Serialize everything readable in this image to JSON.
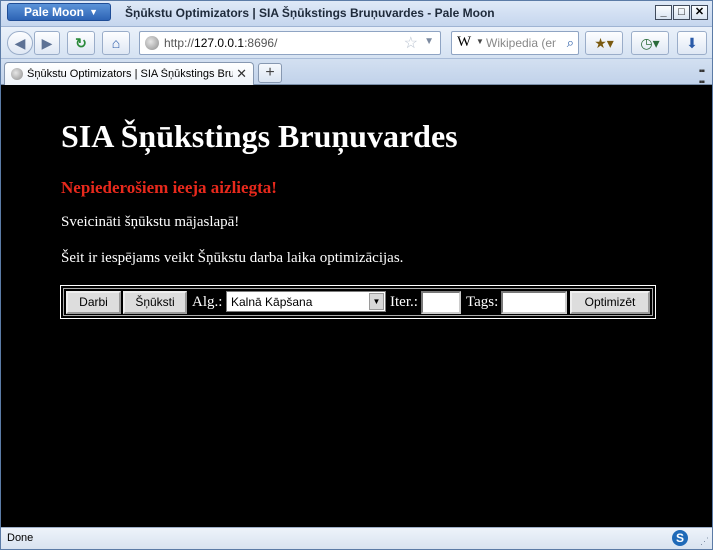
{
  "window": {
    "app_button": "Pale Moon",
    "title": "Šņūkstu Optimizators | SIA Šņūkstings Bruņuvardes - Pale Moon",
    "controls": [
      "_",
      "□",
      "✕"
    ]
  },
  "navbar": {
    "url_prefix": "http://",
    "url_host": "127.0.0.1",
    "url_rest": ":8696/",
    "search_placeholder": "Wikipedia (en)",
    "search_engine_letter": "W"
  },
  "tab": {
    "label": "Šņūkstu Optimizators | SIA Šņūkstings Bruņuvardes",
    "close": "✕",
    "new_tab": "+"
  },
  "page": {
    "heading": "SIA Šņūkstings Bruņuvardes",
    "warning": "Nepiederošiem ieeja aizliegta!",
    "greeting": "Sveicināti šņūkstu mājaslapā!",
    "description": "Šeit ir iespējams veikt Šņūkstu darba laika optimizācijas.",
    "form": {
      "darbi_label": "Darbi",
      "snuksti_label": "Šņūksti",
      "alg_label": "Alg.:",
      "alg_value": "Kalnā Kāpšana",
      "iter_label": "Iter.:",
      "iter_value": "",
      "tags_label": "Tags:",
      "tags_value": "",
      "optimize_label": "Optimizēt"
    }
  },
  "status": {
    "text": "Done",
    "addon_letter": "S"
  }
}
